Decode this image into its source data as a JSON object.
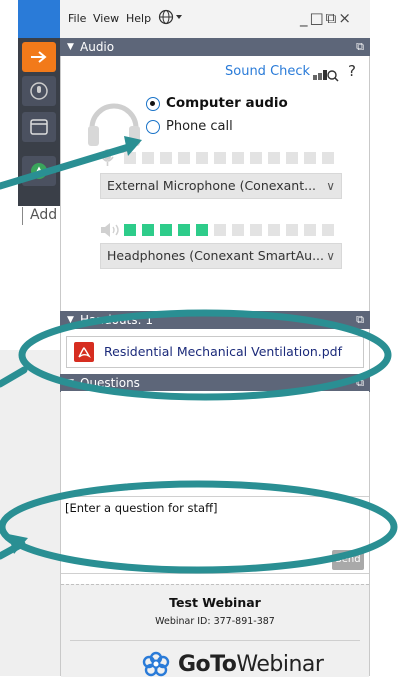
{
  "menu": {
    "file": "File",
    "view": "View",
    "help": "Help",
    "globe_icon": "globe-icon",
    "window_controls": "_□⧉×"
  },
  "audio": {
    "header": "Audio",
    "sound_check": "Sound Check",
    "help": "?",
    "options": [
      "Computer audio",
      "Phone call"
    ],
    "selected": "Computer audio",
    "microphone": "External Microphone (Conexant...",
    "speakers": "Headphones (Conexant SmartAu...",
    "speaker_level_lit": 5,
    "segments": 12
  },
  "left": {
    "add": "Add"
  },
  "handouts": {
    "header": "Handouts: 1",
    "files": [
      "Residential Mechanical Ventilation.pdf"
    ]
  },
  "questions": {
    "header": "Questions",
    "placeholder": "[Enter a question for staff]",
    "send": "Send"
  },
  "footer": {
    "title": "Test Webinar",
    "id": "Webinar ID: 377-891-387",
    "brand_a": "GoTo",
    "brand_b": "Webinar"
  },
  "colors": {
    "accent": "#2a7bd8",
    "header": "#5d6679",
    "annotation": "#2a8f93",
    "level": "#2ecc8a",
    "pdf": "#d62d20"
  }
}
